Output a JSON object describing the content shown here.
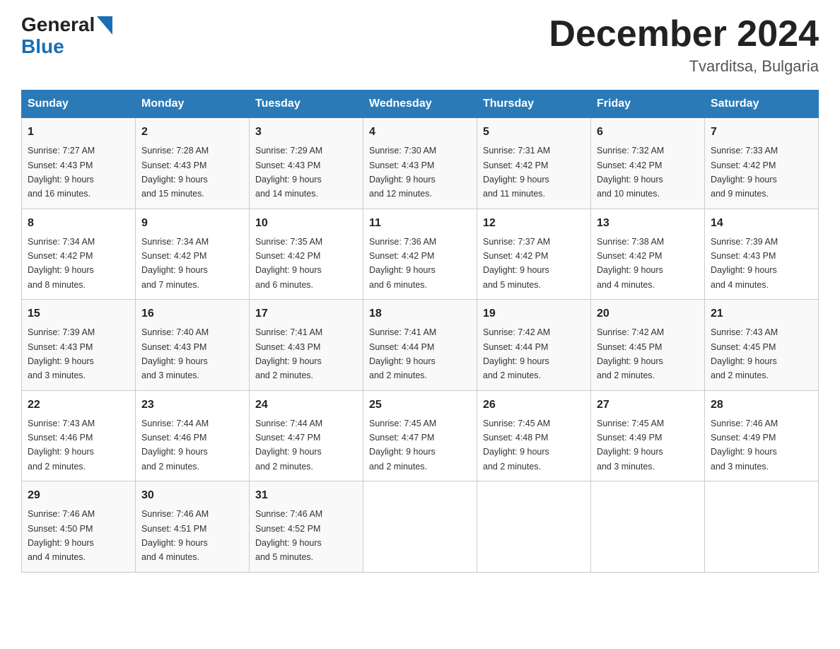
{
  "header": {
    "logo_general": "General",
    "logo_blue": "Blue",
    "month_title": "December 2024",
    "location": "Tvarditsa, Bulgaria"
  },
  "weekdays": [
    "Sunday",
    "Monday",
    "Tuesday",
    "Wednesday",
    "Thursday",
    "Friday",
    "Saturday"
  ],
  "weeks": [
    [
      {
        "day": "1",
        "sunrise": "7:27 AM",
        "sunset": "4:43 PM",
        "daylight": "9 hours and 16 minutes."
      },
      {
        "day": "2",
        "sunrise": "7:28 AM",
        "sunset": "4:43 PM",
        "daylight": "9 hours and 15 minutes."
      },
      {
        "day": "3",
        "sunrise": "7:29 AM",
        "sunset": "4:43 PM",
        "daylight": "9 hours and 14 minutes."
      },
      {
        "day": "4",
        "sunrise": "7:30 AM",
        "sunset": "4:43 PM",
        "daylight": "9 hours and 12 minutes."
      },
      {
        "day": "5",
        "sunrise": "7:31 AM",
        "sunset": "4:42 PM",
        "daylight": "9 hours and 11 minutes."
      },
      {
        "day": "6",
        "sunrise": "7:32 AM",
        "sunset": "4:42 PM",
        "daylight": "9 hours and 10 minutes."
      },
      {
        "day": "7",
        "sunrise": "7:33 AM",
        "sunset": "4:42 PM",
        "daylight": "9 hours and 9 minutes."
      }
    ],
    [
      {
        "day": "8",
        "sunrise": "7:34 AM",
        "sunset": "4:42 PM",
        "daylight": "9 hours and 8 minutes."
      },
      {
        "day": "9",
        "sunrise": "7:34 AM",
        "sunset": "4:42 PM",
        "daylight": "9 hours and 7 minutes."
      },
      {
        "day": "10",
        "sunrise": "7:35 AM",
        "sunset": "4:42 PM",
        "daylight": "9 hours and 6 minutes."
      },
      {
        "day": "11",
        "sunrise": "7:36 AM",
        "sunset": "4:42 PM",
        "daylight": "9 hours and 6 minutes."
      },
      {
        "day": "12",
        "sunrise": "7:37 AM",
        "sunset": "4:42 PM",
        "daylight": "9 hours and 5 minutes."
      },
      {
        "day": "13",
        "sunrise": "7:38 AM",
        "sunset": "4:42 PM",
        "daylight": "9 hours and 4 minutes."
      },
      {
        "day": "14",
        "sunrise": "7:39 AM",
        "sunset": "4:43 PM",
        "daylight": "9 hours and 4 minutes."
      }
    ],
    [
      {
        "day": "15",
        "sunrise": "7:39 AM",
        "sunset": "4:43 PM",
        "daylight": "9 hours and 3 minutes."
      },
      {
        "day": "16",
        "sunrise": "7:40 AM",
        "sunset": "4:43 PM",
        "daylight": "9 hours and 3 minutes."
      },
      {
        "day": "17",
        "sunrise": "7:41 AM",
        "sunset": "4:43 PM",
        "daylight": "9 hours and 2 minutes."
      },
      {
        "day": "18",
        "sunrise": "7:41 AM",
        "sunset": "4:44 PM",
        "daylight": "9 hours and 2 minutes."
      },
      {
        "day": "19",
        "sunrise": "7:42 AM",
        "sunset": "4:44 PM",
        "daylight": "9 hours and 2 minutes."
      },
      {
        "day": "20",
        "sunrise": "7:42 AM",
        "sunset": "4:45 PM",
        "daylight": "9 hours and 2 minutes."
      },
      {
        "day": "21",
        "sunrise": "7:43 AM",
        "sunset": "4:45 PM",
        "daylight": "9 hours and 2 minutes."
      }
    ],
    [
      {
        "day": "22",
        "sunrise": "7:43 AM",
        "sunset": "4:46 PM",
        "daylight": "9 hours and 2 minutes."
      },
      {
        "day": "23",
        "sunrise": "7:44 AM",
        "sunset": "4:46 PM",
        "daylight": "9 hours and 2 minutes."
      },
      {
        "day": "24",
        "sunrise": "7:44 AM",
        "sunset": "4:47 PM",
        "daylight": "9 hours and 2 minutes."
      },
      {
        "day": "25",
        "sunrise": "7:45 AM",
        "sunset": "4:47 PM",
        "daylight": "9 hours and 2 minutes."
      },
      {
        "day": "26",
        "sunrise": "7:45 AM",
        "sunset": "4:48 PM",
        "daylight": "9 hours and 2 minutes."
      },
      {
        "day": "27",
        "sunrise": "7:45 AM",
        "sunset": "4:49 PM",
        "daylight": "9 hours and 3 minutes."
      },
      {
        "day": "28",
        "sunrise": "7:46 AM",
        "sunset": "4:49 PM",
        "daylight": "9 hours and 3 minutes."
      }
    ],
    [
      {
        "day": "29",
        "sunrise": "7:46 AM",
        "sunset": "4:50 PM",
        "daylight": "9 hours and 4 minutes."
      },
      {
        "day": "30",
        "sunrise": "7:46 AM",
        "sunset": "4:51 PM",
        "daylight": "9 hours and 4 minutes."
      },
      {
        "day": "31",
        "sunrise": "7:46 AM",
        "sunset": "4:52 PM",
        "daylight": "9 hours and 5 minutes."
      },
      null,
      null,
      null,
      null
    ]
  ]
}
